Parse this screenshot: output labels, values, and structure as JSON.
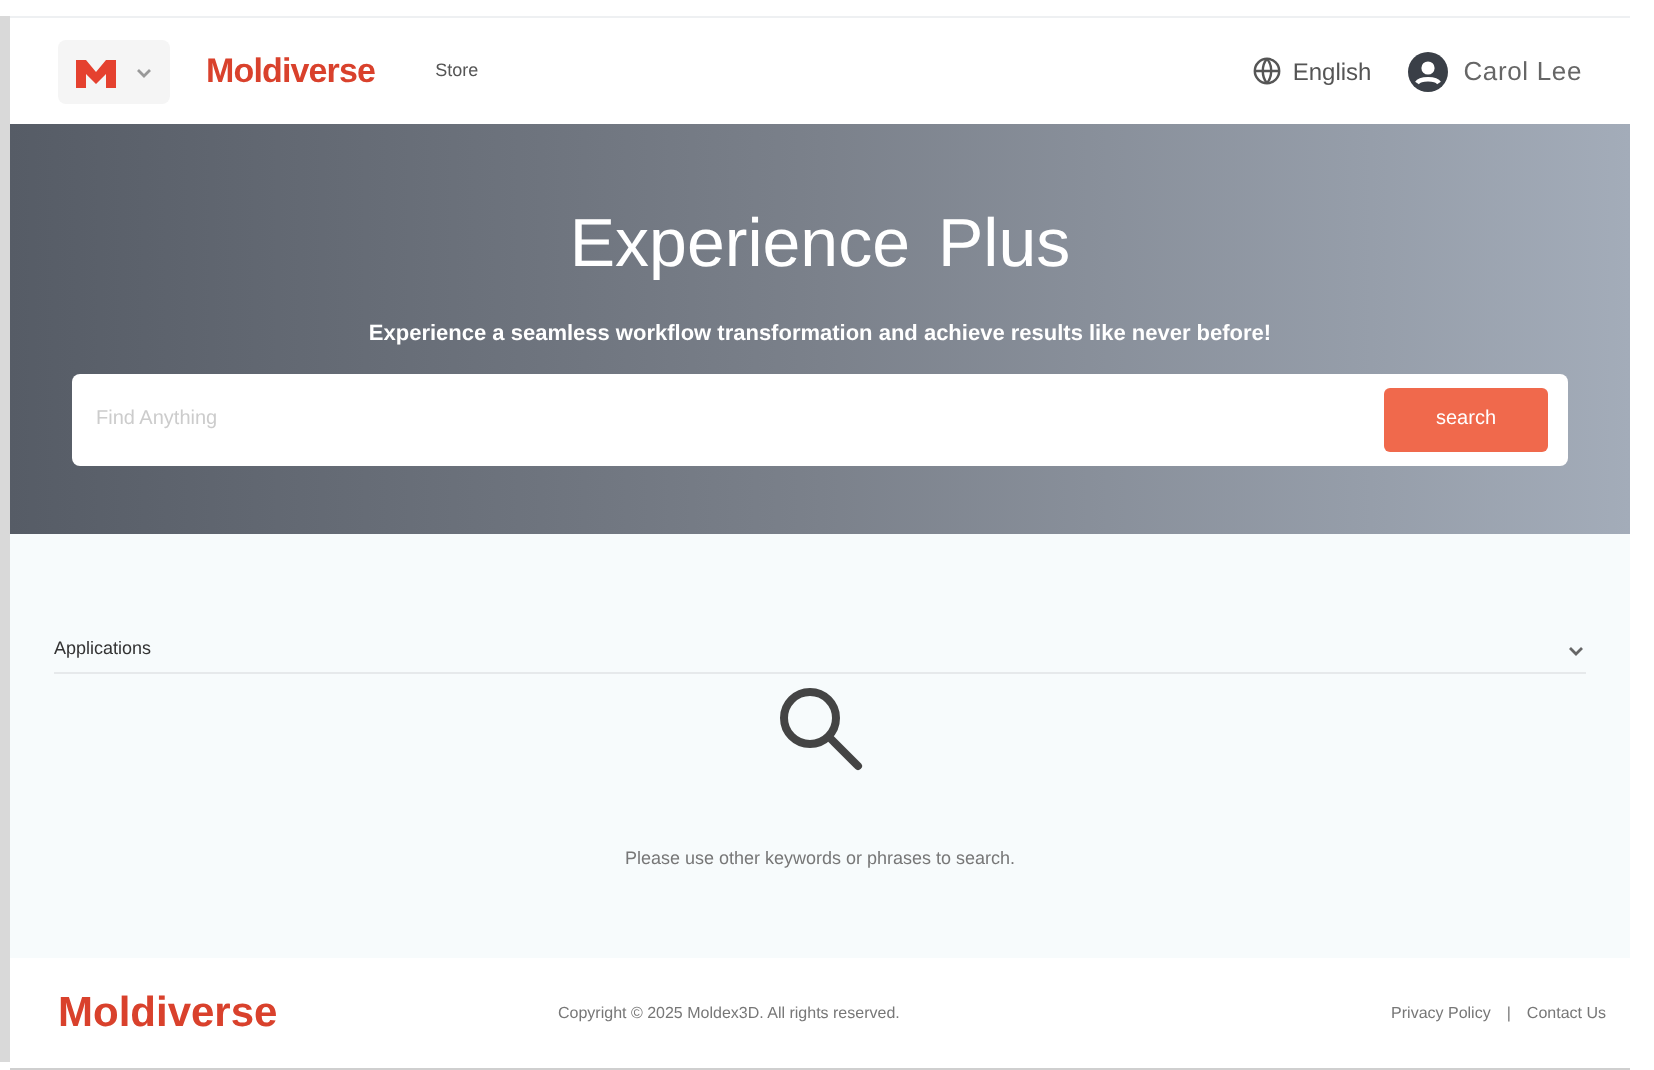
{
  "header": {
    "brand": "Moldiverse",
    "nav": [
      {
        "label": "Store"
      }
    ],
    "language": "English",
    "user": "Carol Lee"
  },
  "hero": {
    "title": "Experience",
    "title_accent": "Plus",
    "subtitle": "Experience a seamless workflow transformation and achieve results like never before!",
    "search": {
      "placeholder": "Find Anything",
      "button": "search"
    }
  },
  "section": {
    "title": "Applications",
    "expanded": true,
    "empty_message": "Please use other keywords or phrases to search."
  },
  "footer": {
    "brand": "Moldiverse",
    "copyright": "Copyright © 2025 Moldex3D. All rights reserved.",
    "links": [
      "Privacy Policy",
      "Contact Us"
    ],
    "separator": "|"
  }
}
